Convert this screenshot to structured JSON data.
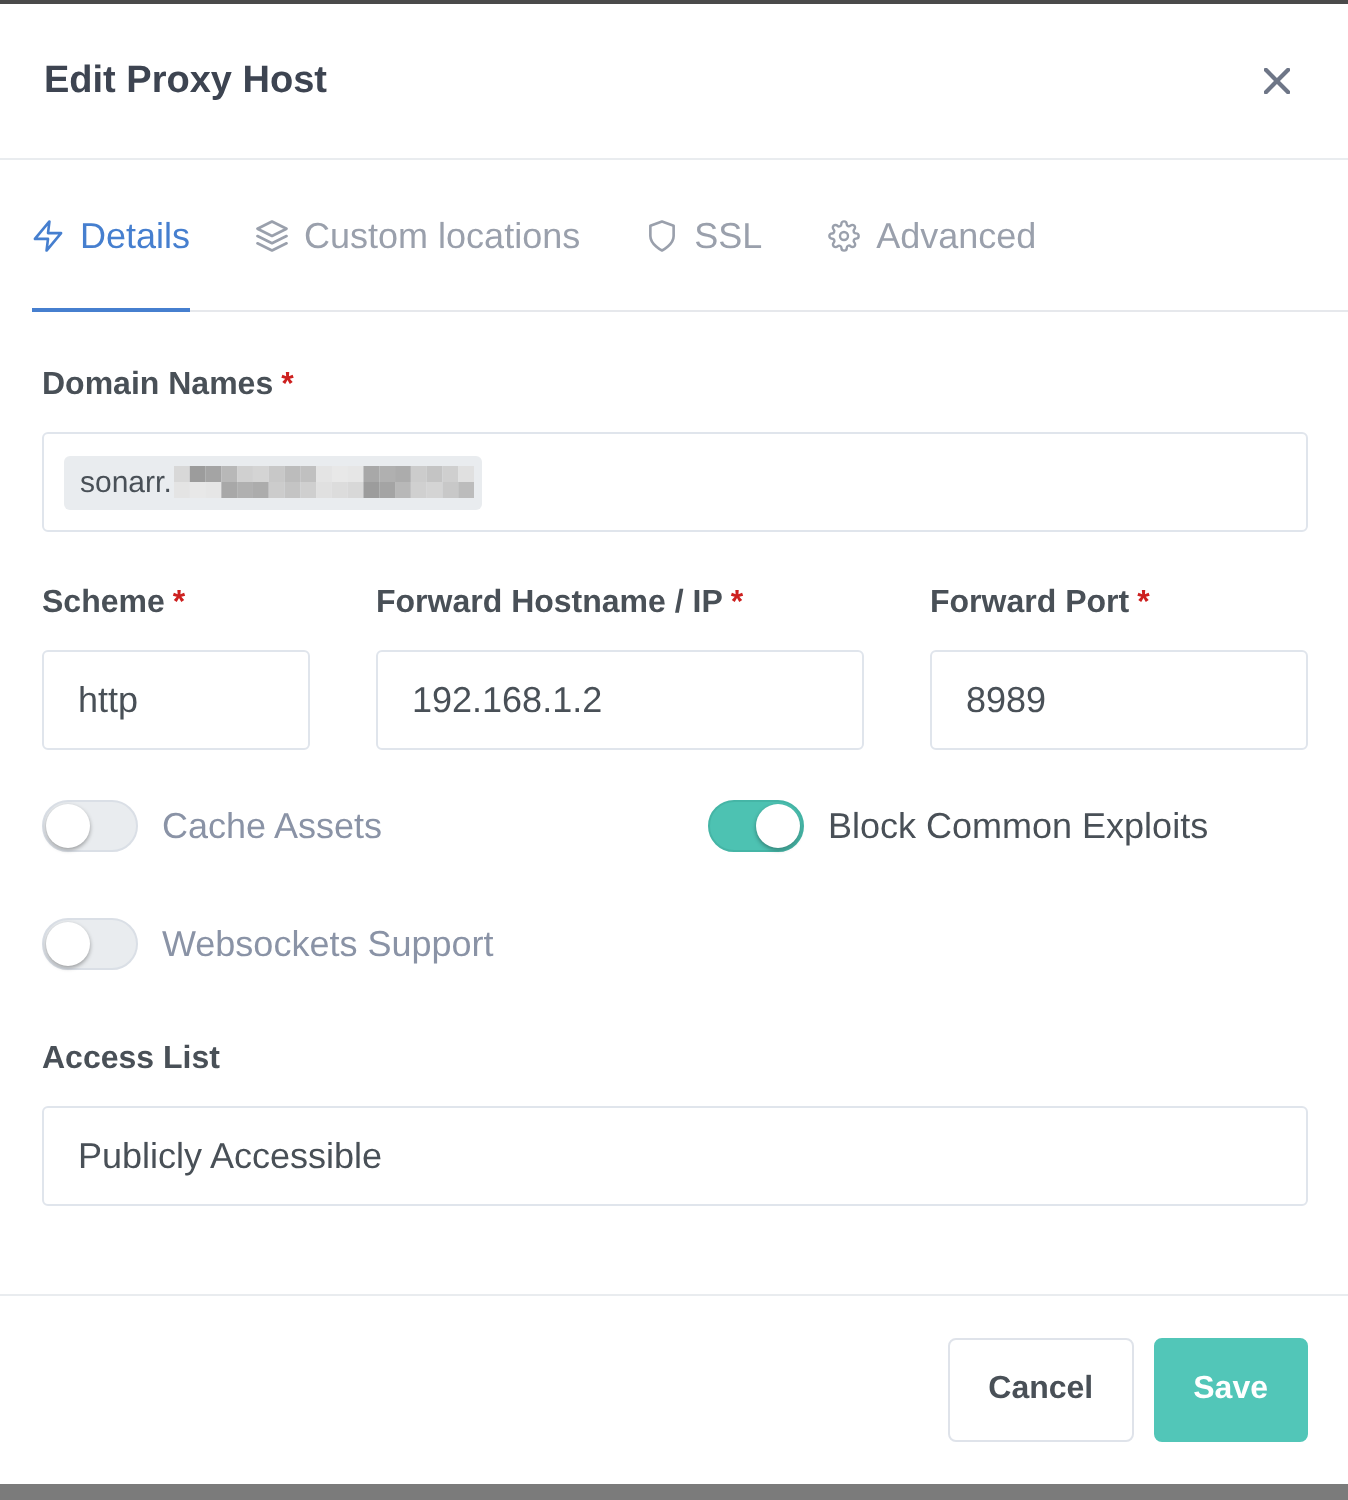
{
  "dialog": {
    "title": "Edit Proxy Host"
  },
  "tabs": [
    {
      "label": "Details",
      "selected": true
    },
    {
      "label": "Custom locations",
      "selected": false
    },
    {
      "label": "SSL",
      "selected": false
    },
    {
      "label": "Advanced",
      "selected": false
    }
  ],
  "domain_names": {
    "label": "Domain Names",
    "required_mark": "*",
    "tags": [
      {
        "text": "sonarr.",
        "redacted": true
      }
    ]
  },
  "forward": [
    {
      "label": "Scheme",
      "required_mark": "*",
      "value": "http"
    },
    {
      "label": "Forward Hostname / IP",
      "required_mark": "*",
      "value": "192.168.1.2"
    },
    {
      "label": "Forward Port",
      "required_mark": "*",
      "value": "8989"
    }
  ],
  "toggles": [
    {
      "label": "Cache Assets",
      "on": false
    },
    {
      "label": "Block Common Exploits",
      "on": true
    },
    {
      "label": "Websockets Support",
      "on": false
    }
  ],
  "access_list": {
    "label": "Access List",
    "value": "Publicly Accessible"
  },
  "buttons": [
    {
      "label": "Cancel",
      "kind": "secondary"
    },
    {
      "label": "Save",
      "kind": "primary"
    }
  ]
}
